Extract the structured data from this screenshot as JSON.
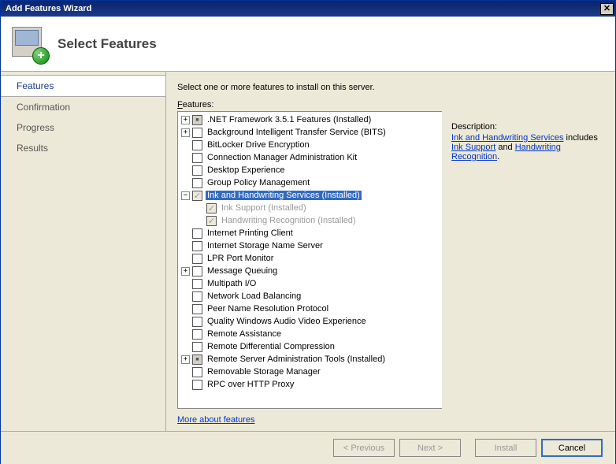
{
  "window": {
    "title": "Add Features Wizard"
  },
  "header": {
    "title": "Select Features"
  },
  "sidebar": {
    "items": [
      {
        "label": "Features",
        "active": true
      },
      {
        "label": "Confirmation",
        "active": false
      },
      {
        "label": "Progress",
        "active": false
      },
      {
        "label": "Results",
        "active": false
      }
    ]
  },
  "main": {
    "instruction": "Select one or more features to install on this server.",
    "features_label_prefix": "F",
    "features_label_rest": "eatures:",
    "more_link": "More about features"
  },
  "tree": [
    {
      "indent": 0,
      "expand": "+",
      "check": "partial",
      "label": ".NET Framework 3.5.1 Features  (Installed)"
    },
    {
      "indent": 0,
      "expand": "+",
      "check": "",
      "label": "Background Intelligent Transfer Service (BITS)"
    },
    {
      "indent": 0,
      "expand": "",
      "check": "",
      "label": "BitLocker Drive Encryption"
    },
    {
      "indent": 0,
      "expand": "",
      "check": "",
      "label": "Connection Manager Administration Kit"
    },
    {
      "indent": 0,
      "expand": "",
      "check": "",
      "label": "Desktop Experience"
    },
    {
      "indent": 0,
      "expand": "",
      "check": "",
      "label": "Group Policy Management"
    },
    {
      "indent": 0,
      "expand": "-",
      "check": "checked-d",
      "label": "Ink and Handwriting Services  (Installed)",
      "selected": true
    },
    {
      "indent": 1,
      "expand": "",
      "check": "checked-d",
      "label": "Ink Support  (Installed)",
      "disabled": true
    },
    {
      "indent": 1,
      "expand": "",
      "check": "checked-d",
      "label": "Handwriting Recognition  (Installed)",
      "disabled": true
    },
    {
      "indent": 0,
      "expand": "",
      "check": "",
      "label": "Internet Printing Client"
    },
    {
      "indent": 0,
      "expand": "",
      "check": "",
      "label": "Internet Storage Name Server"
    },
    {
      "indent": 0,
      "expand": "",
      "check": "",
      "label": "LPR Port Monitor"
    },
    {
      "indent": 0,
      "expand": "+",
      "check": "",
      "label": "Message Queuing"
    },
    {
      "indent": 0,
      "expand": "",
      "check": "",
      "label": "Multipath I/O"
    },
    {
      "indent": 0,
      "expand": "",
      "check": "",
      "label": "Network Load Balancing"
    },
    {
      "indent": 0,
      "expand": "",
      "check": "",
      "label": "Peer Name Resolution Protocol"
    },
    {
      "indent": 0,
      "expand": "",
      "check": "",
      "label": "Quality Windows Audio Video Experience"
    },
    {
      "indent": 0,
      "expand": "",
      "check": "",
      "label": "Remote Assistance"
    },
    {
      "indent": 0,
      "expand": "",
      "check": "",
      "label": "Remote Differential Compression"
    },
    {
      "indent": 0,
      "expand": "+",
      "check": "partial",
      "label": "Remote Server Administration Tools  (Installed)"
    },
    {
      "indent": 0,
      "expand": "",
      "check": "",
      "label": "Removable Storage Manager"
    },
    {
      "indent": 0,
      "expand": "",
      "check": "",
      "label": "RPC over HTTP Proxy"
    }
  ],
  "description": {
    "heading": "Description:",
    "link1": "Ink and Handwriting Services",
    "mid1": " includes ",
    "link2": "Ink Support",
    "mid2": " and ",
    "link3": "Handwriting Recognition",
    "tail": "."
  },
  "footer": {
    "previous": "< Previous",
    "next": "Next >",
    "install": "Install",
    "cancel": "Cancel"
  }
}
